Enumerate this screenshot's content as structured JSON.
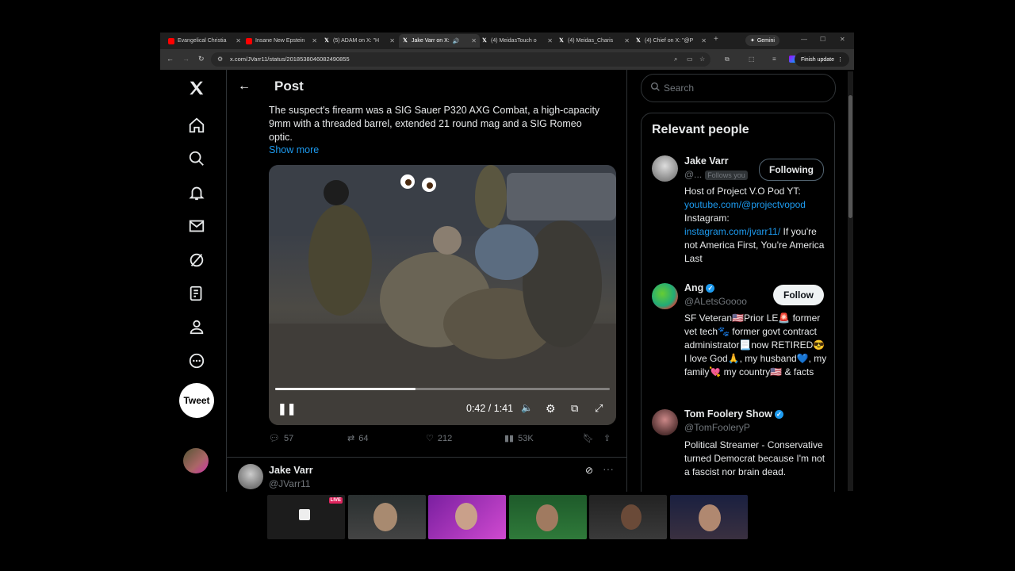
{
  "browser": {
    "tabs": [
      {
        "label": "Evangelical Christia",
        "icon": "youtube-icon"
      },
      {
        "label": "Insane New Epstein",
        "icon": "youtube-icon"
      },
      {
        "label": "(5) ADAM on X: \"H",
        "icon": "x-icon"
      },
      {
        "label": "Jake Varr on X:",
        "icon": "x-icon",
        "active": true
      },
      {
        "label": "(4) MeidasTouch o",
        "icon": "x-icon"
      },
      {
        "label": "(4) Meidas_Charis",
        "icon": "x-icon"
      },
      {
        "label": "(4) Chief on X: \"@P",
        "icon": "x-icon"
      }
    ],
    "gemini_label": "Gemini",
    "url": "x.com/JVarr11/status/2018538046082490855",
    "finish_update_label": "Finish update"
  },
  "x_page": {
    "header_title": "Post",
    "tweet_text": "The suspect's firearm was a SIG Sauer P320 AXG Combat, a high-capacity 9mm with a threaded barrel, extended 21 round mag and a SIG Romeo optic.",
    "show_more": "Show more",
    "video": {
      "time": "0:42 / 1:41",
      "progress": 0.42
    },
    "actions": {
      "replies": "57",
      "reposts": "64",
      "likes": "212",
      "views": "53K"
    },
    "reply": {
      "name": "Jake Varr",
      "handle": "@JVarr11"
    },
    "tweet_button": "Tweet",
    "search_placeholder": "Search",
    "relevant_people_title": "Relevant people",
    "people": [
      {
        "name": "Jake Varr",
        "handle": "@...",
        "badge": "Follows you",
        "button": "Following",
        "bio_1": "Host of Project V.O Pod YT:",
        "bio_link1": "youtube.com/@projectvopod",
        "bio_2": "Instagram:",
        "bio_link2": "instagram.com/jvarr11/",
        "bio_3": " If you're not America First, You're America Last"
      },
      {
        "name": "Ang",
        "handle": "@ALetsGoooo",
        "button": "Follow",
        "bio": "SF Veteran🇺🇸Prior LE🚨 former vet tech🐾 former govt contract administrator📃now RETIRED😎 I love God🙏, my husband💙, my family💘 my country🇺🇸 & facts"
      },
      {
        "name": "Tom Foolery Show",
        "handle": "@TomFooleryP",
        "bio": "Political Streamer - Conservative turned Democrat because I'm not a fascist nor brain dead."
      }
    ]
  },
  "webcams": {
    "live_label": "LIVE"
  }
}
